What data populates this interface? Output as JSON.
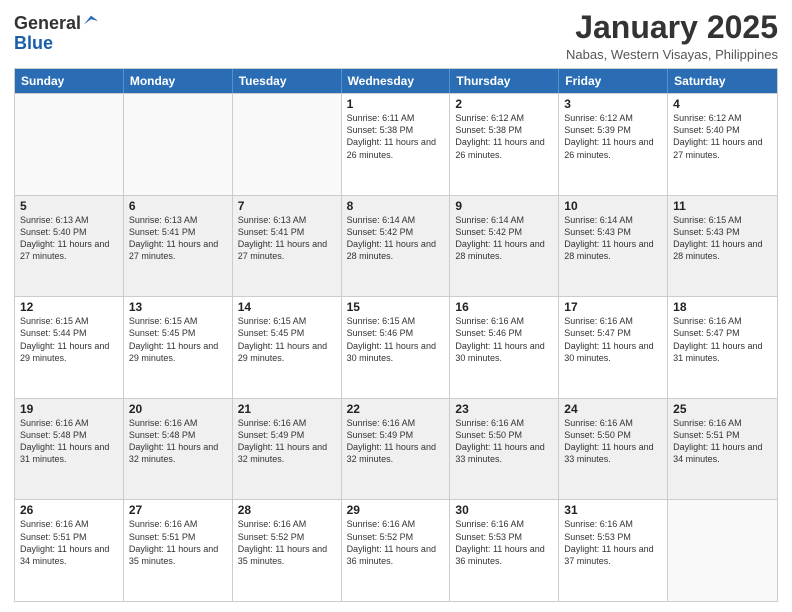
{
  "logo": {
    "general": "General",
    "blue": "Blue"
  },
  "title": "January 2025",
  "subtitle": "Nabas, Western Visayas, Philippines",
  "days": [
    "Sunday",
    "Monday",
    "Tuesday",
    "Wednesday",
    "Thursday",
    "Friday",
    "Saturday"
  ],
  "weeks": [
    [
      {
        "day": "",
        "sunrise": "",
        "sunset": "",
        "daylight": "",
        "empty": true
      },
      {
        "day": "",
        "sunrise": "",
        "sunset": "",
        "daylight": "",
        "empty": true
      },
      {
        "day": "",
        "sunrise": "",
        "sunset": "",
        "daylight": "",
        "empty": true
      },
      {
        "day": "1",
        "sunrise": "Sunrise: 6:11 AM",
        "sunset": "Sunset: 5:38 PM",
        "daylight": "Daylight: 11 hours and 26 minutes.",
        "empty": false
      },
      {
        "day": "2",
        "sunrise": "Sunrise: 6:12 AM",
        "sunset": "Sunset: 5:38 PM",
        "daylight": "Daylight: 11 hours and 26 minutes.",
        "empty": false
      },
      {
        "day": "3",
        "sunrise": "Sunrise: 6:12 AM",
        "sunset": "Sunset: 5:39 PM",
        "daylight": "Daylight: 11 hours and 26 minutes.",
        "empty": false
      },
      {
        "day": "4",
        "sunrise": "Sunrise: 6:12 AM",
        "sunset": "Sunset: 5:40 PM",
        "daylight": "Daylight: 11 hours and 27 minutes.",
        "empty": false
      }
    ],
    [
      {
        "day": "5",
        "sunrise": "Sunrise: 6:13 AM",
        "sunset": "Sunset: 5:40 PM",
        "daylight": "Daylight: 11 hours and 27 minutes.",
        "empty": false
      },
      {
        "day": "6",
        "sunrise": "Sunrise: 6:13 AM",
        "sunset": "Sunset: 5:41 PM",
        "daylight": "Daylight: 11 hours and 27 minutes.",
        "empty": false
      },
      {
        "day": "7",
        "sunrise": "Sunrise: 6:13 AM",
        "sunset": "Sunset: 5:41 PM",
        "daylight": "Daylight: 11 hours and 27 minutes.",
        "empty": false
      },
      {
        "day": "8",
        "sunrise": "Sunrise: 6:14 AM",
        "sunset": "Sunset: 5:42 PM",
        "daylight": "Daylight: 11 hours and 28 minutes.",
        "empty": false
      },
      {
        "day": "9",
        "sunrise": "Sunrise: 6:14 AM",
        "sunset": "Sunset: 5:42 PM",
        "daylight": "Daylight: 11 hours and 28 minutes.",
        "empty": false
      },
      {
        "day": "10",
        "sunrise": "Sunrise: 6:14 AM",
        "sunset": "Sunset: 5:43 PM",
        "daylight": "Daylight: 11 hours and 28 minutes.",
        "empty": false
      },
      {
        "day": "11",
        "sunrise": "Sunrise: 6:15 AM",
        "sunset": "Sunset: 5:43 PM",
        "daylight": "Daylight: 11 hours and 28 minutes.",
        "empty": false
      }
    ],
    [
      {
        "day": "12",
        "sunrise": "Sunrise: 6:15 AM",
        "sunset": "Sunset: 5:44 PM",
        "daylight": "Daylight: 11 hours and 29 minutes.",
        "empty": false
      },
      {
        "day": "13",
        "sunrise": "Sunrise: 6:15 AM",
        "sunset": "Sunset: 5:45 PM",
        "daylight": "Daylight: 11 hours and 29 minutes.",
        "empty": false
      },
      {
        "day": "14",
        "sunrise": "Sunrise: 6:15 AM",
        "sunset": "Sunset: 5:45 PM",
        "daylight": "Daylight: 11 hours and 29 minutes.",
        "empty": false
      },
      {
        "day": "15",
        "sunrise": "Sunrise: 6:15 AM",
        "sunset": "Sunset: 5:46 PM",
        "daylight": "Daylight: 11 hours and 30 minutes.",
        "empty": false
      },
      {
        "day": "16",
        "sunrise": "Sunrise: 6:16 AM",
        "sunset": "Sunset: 5:46 PM",
        "daylight": "Daylight: 11 hours and 30 minutes.",
        "empty": false
      },
      {
        "day": "17",
        "sunrise": "Sunrise: 6:16 AM",
        "sunset": "Sunset: 5:47 PM",
        "daylight": "Daylight: 11 hours and 30 minutes.",
        "empty": false
      },
      {
        "day": "18",
        "sunrise": "Sunrise: 6:16 AM",
        "sunset": "Sunset: 5:47 PM",
        "daylight": "Daylight: 11 hours and 31 minutes.",
        "empty": false
      }
    ],
    [
      {
        "day": "19",
        "sunrise": "Sunrise: 6:16 AM",
        "sunset": "Sunset: 5:48 PM",
        "daylight": "Daylight: 11 hours and 31 minutes.",
        "empty": false
      },
      {
        "day": "20",
        "sunrise": "Sunrise: 6:16 AM",
        "sunset": "Sunset: 5:48 PM",
        "daylight": "Daylight: 11 hours and 32 minutes.",
        "empty": false
      },
      {
        "day": "21",
        "sunrise": "Sunrise: 6:16 AM",
        "sunset": "Sunset: 5:49 PM",
        "daylight": "Daylight: 11 hours and 32 minutes.",
        "empty": false
      },
      {
        "day": "22",
        "sunrise": "Sunrise: 6:16 AM",
        "sunset": "Sunset: 5:49 PM",
        "daylight": "Daylight: 11 hours and 32 minutes.",
        "empty": false
      },
      {
        "day": "23",
        "sunrise": "Sunrise: 6:16 AM",
        "sunset": "Sunset: 5:50 PM",
        "daylight": "Daylight: 11 hours and 33 minutes.",
        "empty": false
      },
      {
        "day": "24",
        "sunrise": "Sunrise: 6:16 AM",
        "sunset": "Sunset: 5:50 PM",
        "daylight": "Daylight: 11 hours and 33 minutes.",
        "empty": false
      },
      {
        "day": "25",
        "sunrise": "Sunrise: 6:16 AM",
        "sunset": "Sunset: 5:51 PM",
        "daylight": "Daylight: 11 hours and 34 minutes.",
        "empty": false
      }
    ],
    [
      {
        "day": "26",
        "sunrise": "Sunrise: 6:16 AM",
        "sunset": "Sunset: 5:51 PM",
        "daylight": "Daylight: 11 hours and 34 minutes.",
        "empty": false
      },
      {
        "day": "27",
        "sunrise": "Sunrise: 6:16 AM",
        "sunset": "Sunset: 5:51 PM",
        "daylight": "Daylight: 11 hours and 35 minutes.",
        "empty": false
      },
      {
        "day": "28",
        "sunrise": "Sunrise: 6:16 AM",
        "sunset": "Sunset: 5:52 PM",
        "daylight": "Daylight: 11 hours and 35 minutes.",
        "empty": false
      },
      {
        "day": "29",
        "sunrise": "Sunrise: 6:16 AM",
        "sunset": "Sunset: 5:52 PM",
        "daylight": "Daylight: 11 hours and 36 minutes.",
        "empty": false
      },
      {
        "day": "30",
        "sunrise": "Sunrise: 6:16 AM",
        "sunset": "Sunset: 5:53 PM",
        "daylight": "Daylight: 11 hours and 36 minutes.",
        "empty": false
      },
      {
        "day": "31",
        "sunrise": "Sunrise: 6:16 AM",
        "sunset": "Sunset: 5:53 PM",
        "daylight": "Daylight: 11 hours and 37 minutes.",
        "empty": false
      },
      {
        "day": "",
        "sunrise": "",
        "sunset": "",
        "daylight": "",
        "empty": true
      }
    ]
  ]
}
